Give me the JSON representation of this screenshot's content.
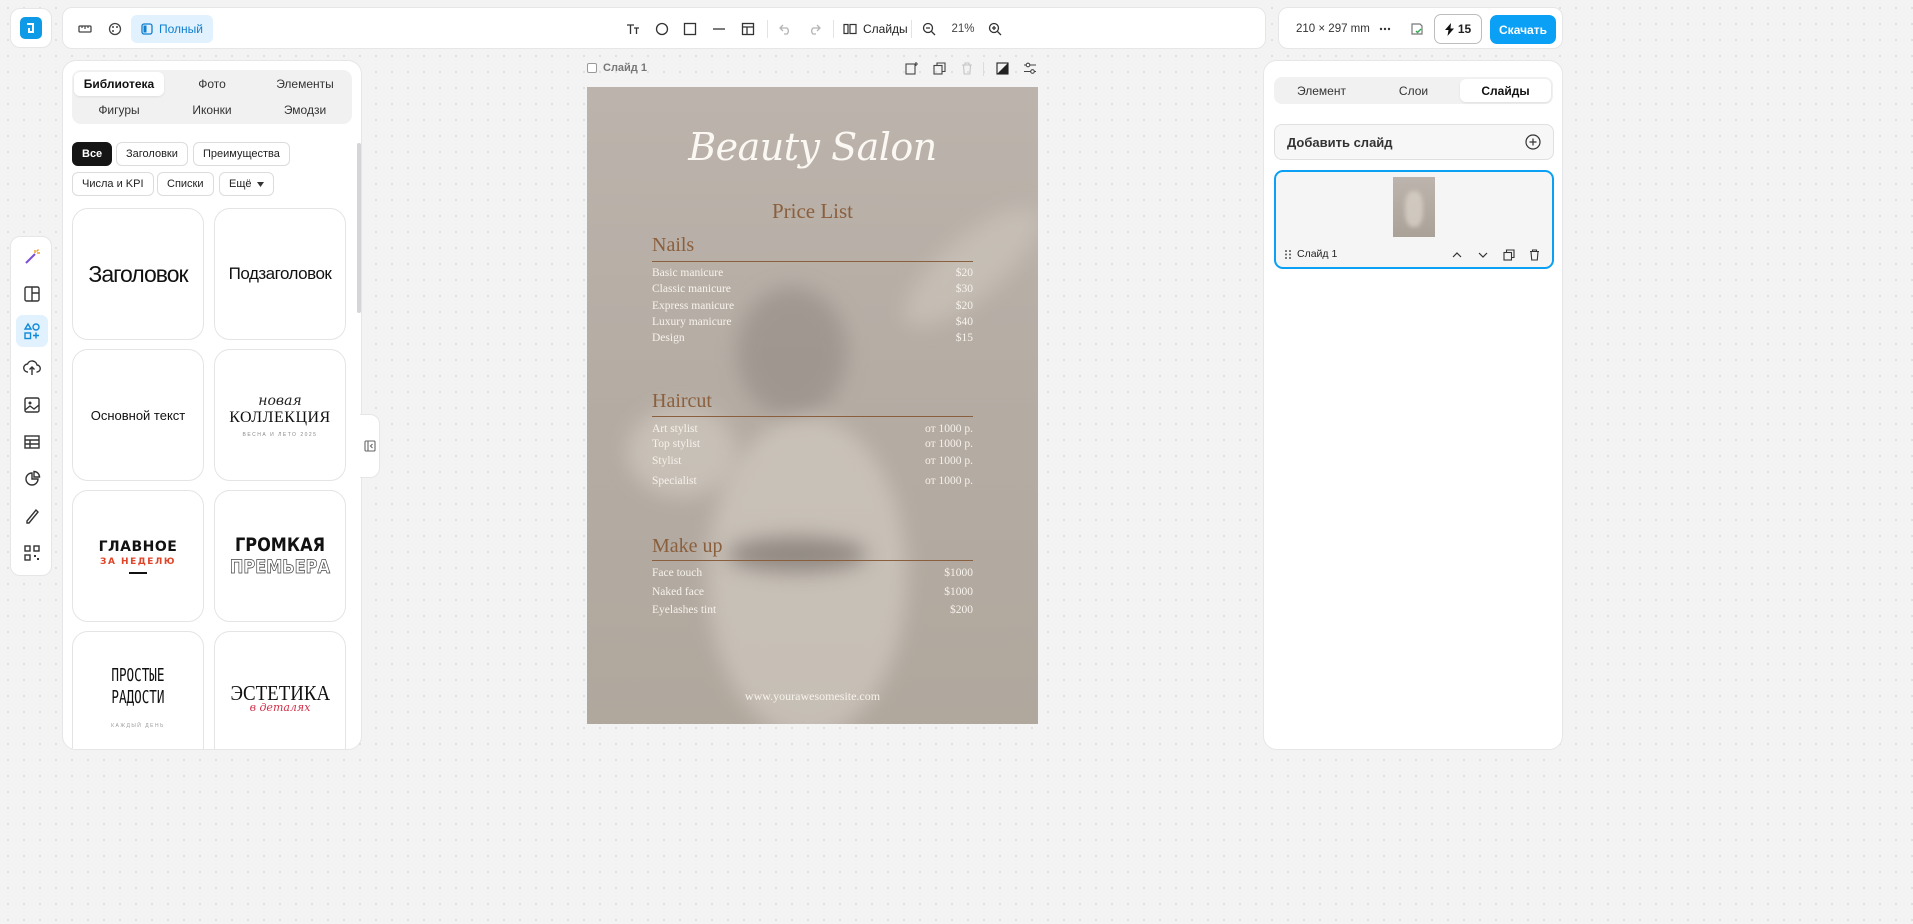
{
  "toolbar": {
    "mode_label": "Полный",
    "slides_label": "Слайды",
    "zoom": "21%",
    "page_size": "210 × 297 mm",
    "credits": "15",
    "download_label": "Скачать"
  },
  "library": {
    "tabs": [
      "Библиотека",
      "Фото",
      "Элементы",
      "Фигуры",
      "Иконки",
      "Эмодзи"
    ],
    "filters": [
      "Все",
      "Заголовки",
      "Преимущества",
      "Числа и KPI",
      "Списки",
      "Ещё"
    ],
    "tiles": {
      "t1": "Заголовок",
      "t2": "Подзаголовок",
      "t3": "Основной текст",
      "t4_a": "новая",
      "t4_b": "КОЛЛЕКЦИЯ",
      "t4_c": "ВЕСНА И ЛЕТО 2025",
      "t5_a": "ГЛАВНОЕ",
      "t5_b": "ЗА НЕДЕЛЮ",
      "t6_a": "ГРОМКАЯ",
      "t6_b": "ПРЕМЬЕРА",
      "t7_a": "ПРОСТЫЕ",
      "t7_b": "РАДОСТИ",
      "t7_c": "КАЖДЫЙ ДЕНЬ",
      "t8_a": "ЭСТЕТИКА",
      "t8_b": "в деталях"
    }
  },
  "canvas": {
    "slide_name": "Слайд 1"
  },
  "slide": {
    "title": "Beauty Salon",
    "subtitle": "Price List",
    "sections": [
      {
        "name": "Nails",
        "items": [
          {
            "name": "Basic manicure",
            "price": "$20"
          },
          {
            "name": "Classic manicure",
            "price": "$30"
          },
          {
            "name": "Express manicure",
            "price": "$20"
          },
          {
            "name": "Luxury manicure",
            "price": "$40"
          },
          {
            "name": "Design",
            "price": "$15"
          }
        ]
      },
      {
        "name": "Haircut",
        "items": [
          {
            "name": "Art stylist",
            "price": "от 1000 р."
          },
          {
            "name": "Top stylist",
            "price": "от 1000 р."
          },
          {
            "name": "Stylist",
            "price": "от 1000 р."
          },
          {
            "name": "Specialist",
            "price": "от 1000 р."
          }
        ]
      },
      {
        "name": "Make up",
        "items": [
          {
            "name": "Face touch",
            "price": "$1000"
          },
          {
            "name": "Naked face",
            "price": "$1000"
          },
          {
            "name": "Eyelashes tint",
            "price": "$200"
          }
        ]
      }
    ],
    "website": "www.yourawesomesite.com"
  },
  "right_panel": {
    "tabs": [
      "Элемент",
      "Слои",
      "Слайды"
    ],
    "add_slide": "Добавить слайд",
    "slide_label": "Слайд 1"
  }
}
